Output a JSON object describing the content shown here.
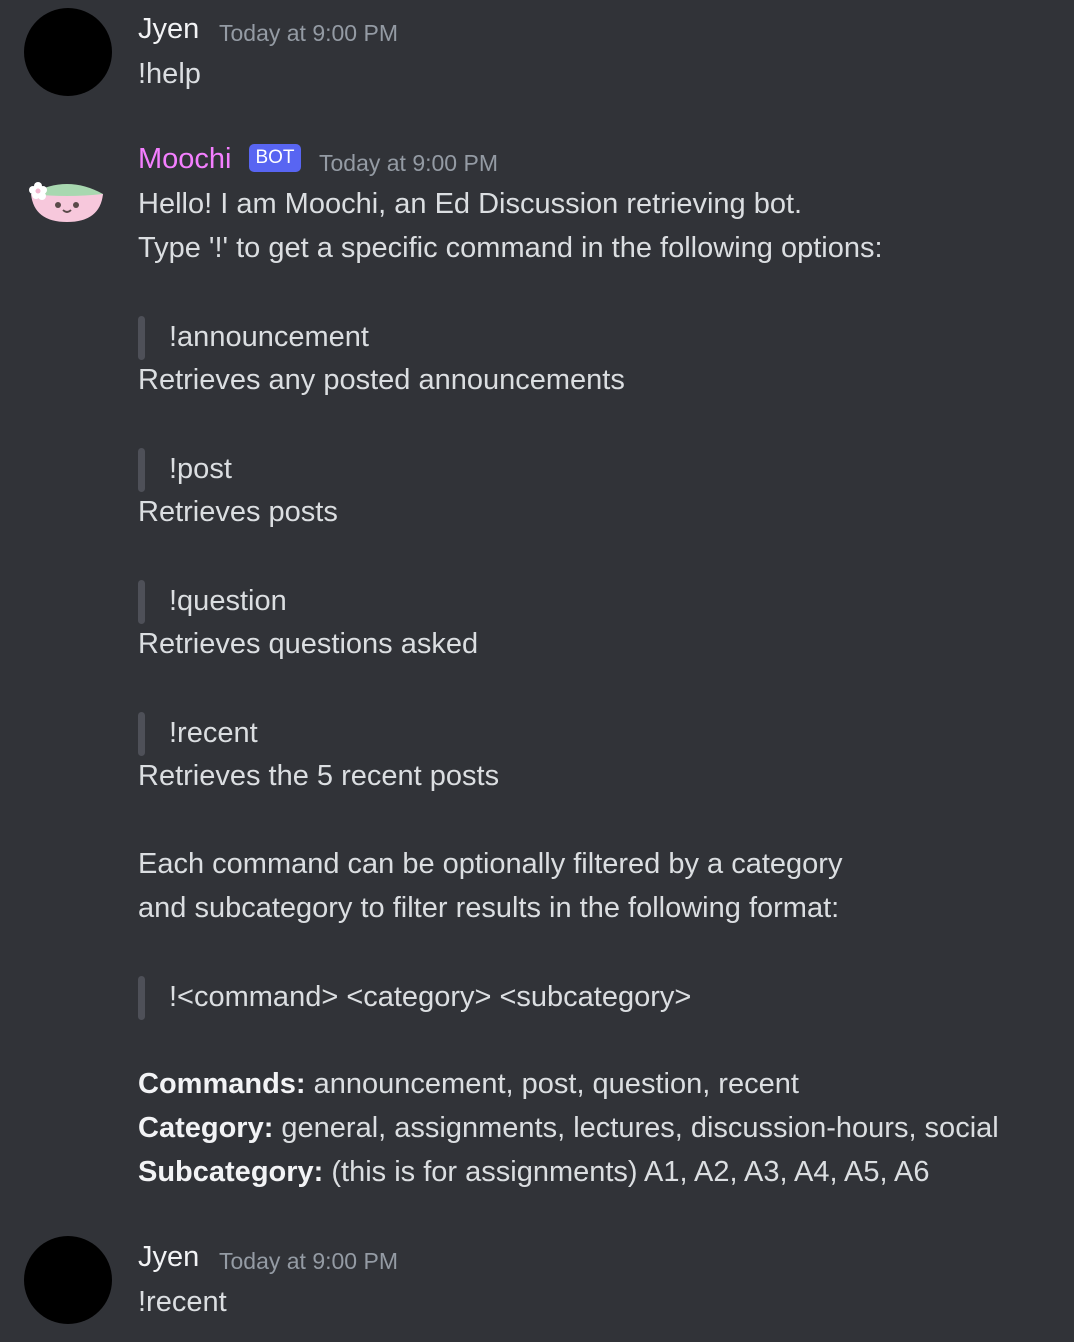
{
  "messages": [
    {
      "author": "Jyen",
      "timestamp": "Today at 9:00 PM",
      "content": "!help"
    },
    {
      "author": "Moochi",
      "badge": "BOT",
      "timestamp": "Today at 9:00 PM",
      "author_color": "#f47fff",
      "intro": [
        "Hello! I am Moochi, an Ed Discussion retrieving bot.",
        "Type '!' to get a specific command in the following options:"
      ],
      "commands": [
        {
          "name": "!announcement",
          "description": "Retrieves any posted announcements"
        },
        {
          "name": "!post",
          "description": "Retrieves posts"
        },
        {
          "name": "!question",
          "description": "Retrieves questions asked"
        },
        {
          "name": "!recent",
          "description": "Retrieves the 5 recent posts"
        }
      ],
      "filter_text": [
        "Each command can be optionally filtered by a category",
        "and subcategory to filter results in the following format:"
      ],
      "format": "!<command> <category> <subcategory>",
      "details": [
        {
          "label": "Commands:",
          "value": "announcement, post, question, recent"
        },
        {
          "label": "Category:",
          "value": "general, assignments, lectures, discussion-hours, social"
        },
        {
          "label": "Subcategory:",
          "value": "(this is for assignments) A1, A2, A3, A4, A5, A6"
        }
      ]
    },
    {
      "author": "Jyen",
      "timestamp": "Today at 9:00 PM",
      "content": "!recent"
    }
  ],
  "colors": {
    "background": "#313338",
    "bot_badge": "#5865f2",
    "bot_name": "#f47fff"
  },
  "icons": {
    "bot_avatar": "moochi-mochi-avatar-icon"
  }
}
